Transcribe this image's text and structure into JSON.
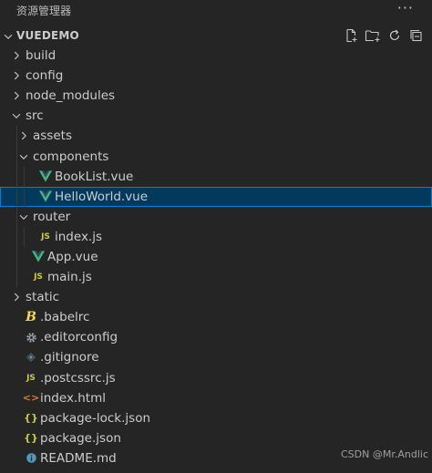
{
  "panel": {
    "title": "资源管理器",
    "more_label": "···"
  },
  "section": {
    "title": "VUEDEMO",
    "actions": [
      "new-file-icon",
      "new-folder-icon",
      "refresh-icon",
      "collapse-all-icon"
    ]
  },
  "colors": {
    "background": "#252526",
    "selection": "#04395e",
    "selection_border": "#007fd4",
    "text": "#cccccc",
    "vue_green": "#41b883",
    "js_yellow": "#cbcb41"
  },
  "tree": [
    {
      "label": "build",
      "type": "folder",
      "depth": 0,
      "expanded": false,
      "icon": "none"
    },
    {
      "label": "config",
      "type": "folder",
      "depth": 0,
      "expanded": false,
      "icon": "none"
    },
    {
      "label": "node_modules",
      "type": "folder",
      "depth": 0,
      "expanded": false,
      "icon": "none"
    },
    {
      "label": "src",
      "type": "folder",
      "depth": 0,
      "expanded": true,
      "icon": "none"
    },
    {
      "label": "assets",
      "type": "folder",
      "depth": 1,
      "expanded": false,
      "icon": "none"
    },
    {
      "label": "components",
      "type": "folder",
      "depth": 1,
      "expanded": true,
      "icon": "none"
    },
    {
      "label": "BookList.vue",
      "type": "file",
      "depth": 2,
      "icon": "vue"
    },
    {
      "label": "HelloWorld.vue",
      "type": "file",
      "depth": 2,
      "icon": "vue",
      "selected": true
    },
    {
      "label": "router",
      "type": "folder",
      "depth": 1,
      "expanded": true,
      "icon": "none"
    },
    {
      "label": "index.js",
      "type": "file",
      "depth": 2,
      "icon": "js"
    },
    {
      "label": "App.vue",
      "type": "file",
      "depth": 1,
      "icon": "vue"
    },
    {
      "label": "main.js",
      "type": "file",
      "depth": 1,
      "icon": "js"
    },
    {
      "label": "static",
      "type": "folder",
      "depth": 0,
      "expanded": false,
      "icon": "none"
    },
    {
      "label": ".babelrc",
      "type": "file",
      "depth": 0,
      "icon": "babel"
    },
    {
      "label": ".editorconfig",
      "type": "file",
      "depth": 0,
      "icon": "gear"
    },
    {
      "label": ".gitignore",
      "type": "file",
      "depth": 0,
      "icon": "git"
    },
    {
      "label": ".postcssrc.js",
      "type": "file",
      "depth": 0,
      "icon": "js"
    },
    {
      "label": "index.html",
      "type": "file",
      "depth": 0,
      "icon": "html"
    },
    {
      "label": "package-lock.json",
      "type": "file",
      "depth": 0,
      "icon": "json"
    },
    {
      "label": "package.json",
      "type": "file",
      "depth": 0,
      "icon": "json"
    },
    {
      "label": "README.md",
      "type": "file",
      "depth": 0,
      "icon": "info"
    }
  ],
  "watermark": "CSDN @Mr.Andlic"
}
